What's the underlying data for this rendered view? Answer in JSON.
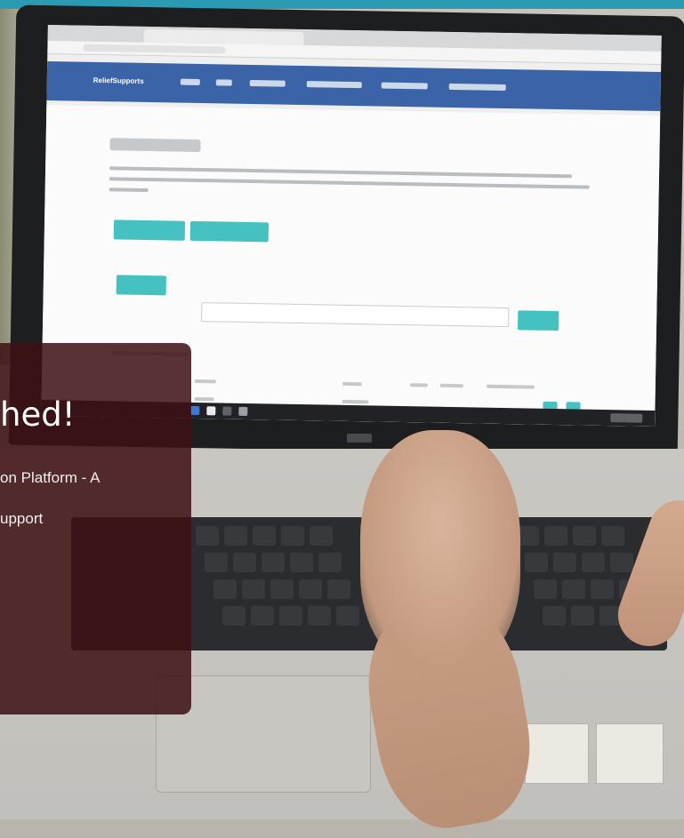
{
  "overlay": {
    "title": "hed!",
    "line1": "on Platform - A",
    "line2": "upport"
  },
  "screen": {
    "brand": "ReliefSupports"
  },
  "colors": {
    "overlay_bg": "#3e1014",
    "navbar": "#3a63a8",
    "teal_button": "#45c1c2",
    "top_strip": "#2a9bb3"
  }
}
